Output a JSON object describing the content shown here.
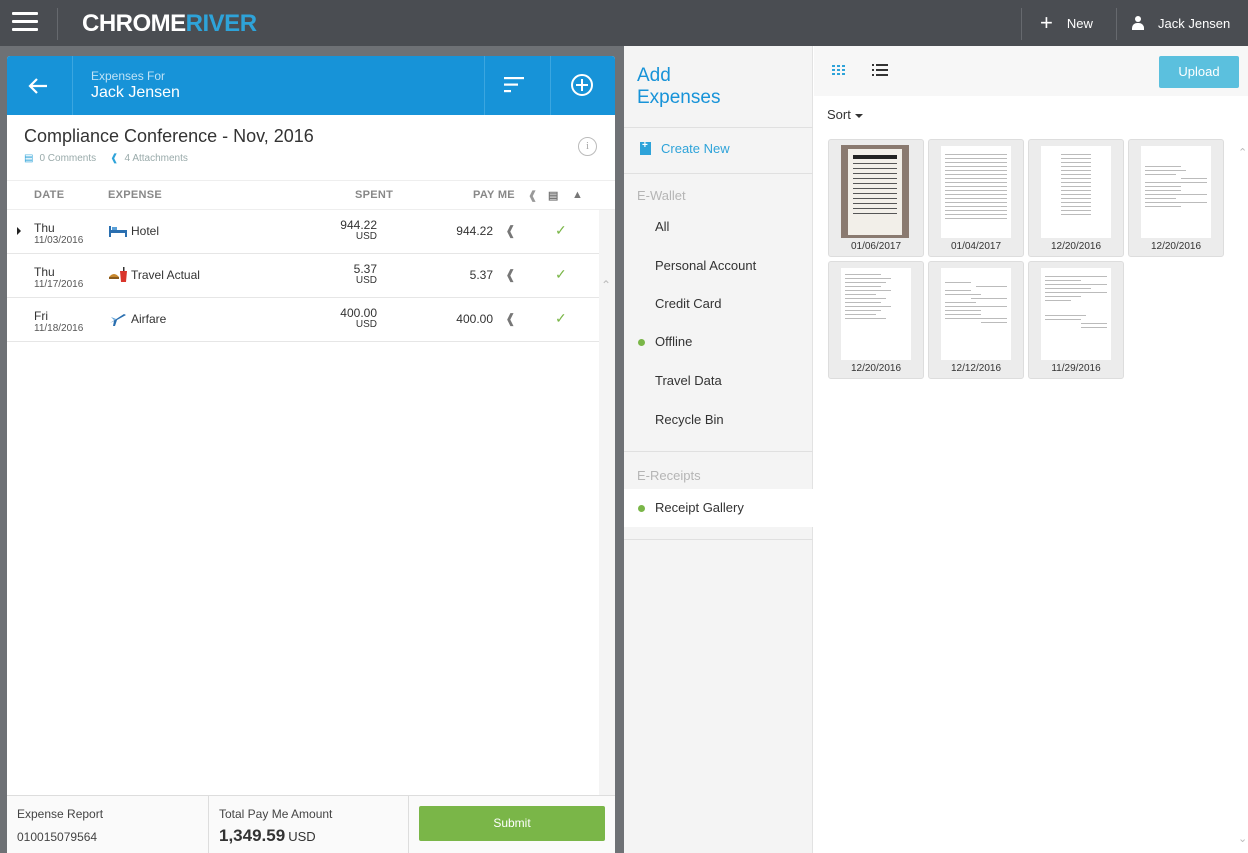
{
  "topbar": {
    "logo_main": "CHROME",
    "logo_accent": "RIVER",
    "new_label": "New",
    "user_name": "Jack Jensen"
  },
  "panel": {
    "header_sub": "Expenses For",
    "header_name": "Jack Jensen",
    "report_title": "Compliance Conference - Nov, 2016",
    "comments": "0 Comments",
    "attachments": "4 Attachments",
    "columns": {
      "date": "DATE",
      "expense": "EXPENSE",
      "spent": "SPENT",
      "payme": "PAY ME"
    },
    "rows": [
      {
        "day": "Thu",
        "date": "11/03/2016",
        "icon": "hotel-icon",
        "category": "Hotel",
        "spent": "944.22",
        "currency": "USD",
        "payme": "944.22"
      },
      {
        "day": "Thu",
        "date": "11/17/2016",
        "icon": "food-icon",
        "category": "Travel Actual",
        "spent": "5.37",
        "currency": "USD",
        "payme": "5.37"
      },
      {
        "day": "Fri",
        "date": "11/18/2016",
        "icon": "airplane-icon",
        "category": "Airfare",
        "spent": "400.00",
        "currency": "USD",
        "payme": "400.00"
      }
    ],
    "footer": {
      "report_label": "Expense Report",
      "report_number": "010015079564",
      "total_label": "Total Pay Me Amount",
      "total_value": "1,349.59",
      "total_currency": "USD",
      "submit": "Submit"
    }
  },
  "nav": {
    "title_line1": "Add",
    "title_line2": "Expenses",
    "create_new": "Create New",
    "ewallet_label": "E-Wallet",
    "ewallet_items": [
      "All",
      "Personal Account",
      "Credit Card",
      "Offline",
      "Travel Data",
      "Recycle Bin"
    ],
    "ereceipts_label": "E-Receipts",
    "ereceipts_items": [
      "Receipt Gallery"
    ]
  },
  "gallery": {
    "upload": "Upload",
    "sort": "Sort",
    "thumbs": [
      "01/06/2017",
      "01/04/2017",
      "12/20/2016",
      "12/20/2016",
      "12/20/2016",
      "12/12/2016",
      "11/29/2016"
    ]
  },
  "colors": {
    "primary_blue": "#1793d8",
    "success_green": "#7ab648",
    "topbar": "#4a4d52",
    "upload_btn": "#5bc0de"
  }
}
